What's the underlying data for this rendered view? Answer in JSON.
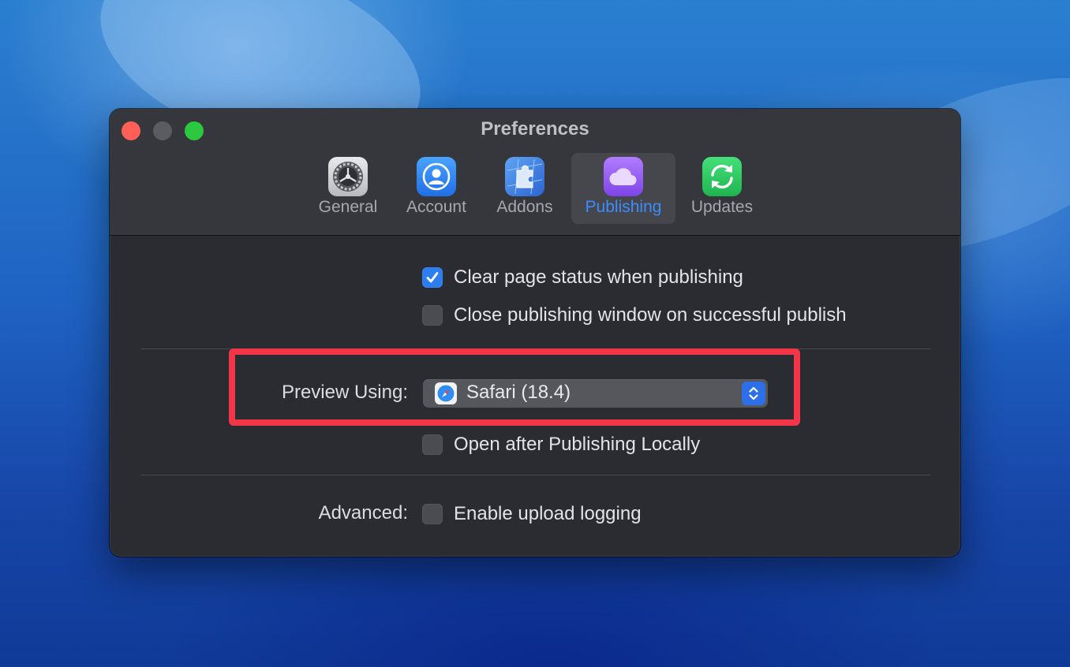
{
  "window": {
    "title": "Preferences"
  },
  "tabs": [
    {
      "label": "General",
      "icon": "gear-icon",
      "active": false
    },
    {
      "label": "Account",
      "icon": "person-icon",
      "active": false
    },
    {
      "label": "Addons",
      "icon": "puzzle-icon",
      "active": false
    },
    {
      "label": "Publishing",
      "icon": "cloud-icon",
      "active": true
    },
    {
      "label": "Updates",
      "icon": "refresh-icon",
      "active": false
    }
  ],
  "options": {
    "clear_status": {
      "label": "Clear page status when publishing",
      "checked": true
    },
    "close_window": {
      "label": "Close publishing window on successful publish",
      "checked": false
    }
  },
  "preview": {
    "label": "Preview Using:",
    "selected": "Safari (18.4)",
    "icon": "safari-icon",
    "open_after": {
      "label": "Open after Publishing Locally",
      "checked": false
    }
  },
  "advanced": {
    "label": "Advanced:",
    "logging": {
      "label": "Enable upload logging",
      "checked": false
    }
  },
  "colors": {
    "accent": "#2c7df0",
    "active_tab_label": "#3b8cff",
    "highlight": "#f23548"
  }
}
